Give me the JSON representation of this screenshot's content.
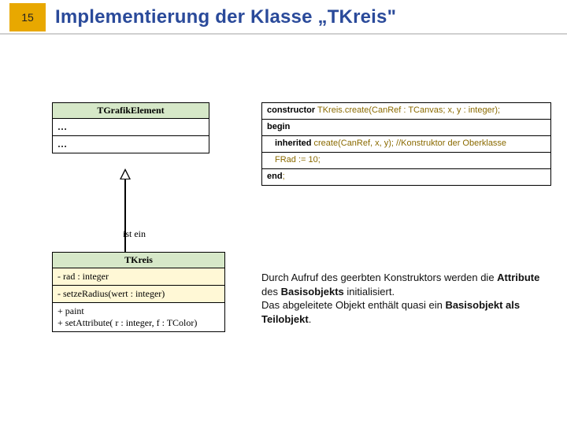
{
  "page_number": "15",
  "title": "Implementierung der Klasse „TKreis\"",
  "uml": {
    "grafik": {
      "name": "TGrafikElement",
      "row1": "…",
      "row2": "…"
    },
    "relation_label": "ist ein",
    "kreis": {
      "name": "TKreis",
      "attr1": "- rad : integer",
      "attr2": "- setzeRadius(wert : integer)",
      "op1": "+ paint",
      "op2": "+ setAttribute( r : integer, f : TColor)"
    }
  },
  "code": {
    "kw_constructor": "constructor",
    "sig_rest": " TKreis.create(CanRef : TCanvas; x, y : integer);",
    "kw_begin": "begin",
    "kw_inherited": "inherited",
    "inherited_rest": " create(CanRef, x, y); ",
    "inherited_comment": "//Konstruktor der Oberklasse",
    "body_line": "FRad := 10;",
    "kw_end": "end",
    "end_semicolon": ";"
  },
  "paragraph": {
    "p1a": "Durch Aufruf des geerbten Konstruktors werden die ",
    "p1b": "Attribute",
    "p1c": " des ",
    "p1d": "Basisobjekts",
    "p1e": " initialisiert.",
    "p2a": "Das abgeleitete Objekt enthält quasi ein ",
    "p2b": "Basisobjekt als Teilobjekt",
    "p2c": "."
  }
}
